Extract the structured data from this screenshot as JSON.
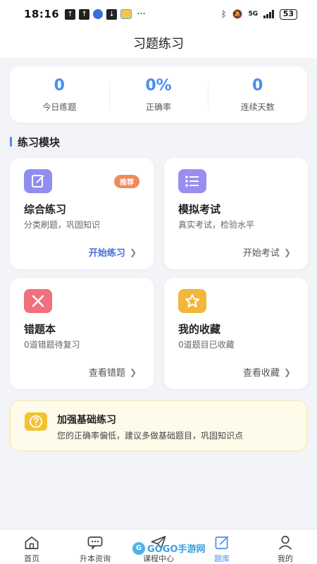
{
  "status_bar": {
    "time": "18:16",
    "more": "···",
    "network": "5G",
    "battery": "53"
  },
  "header": {
    "title": "习题练习"
  },
  "stats": [
    {
      "value": "0",
      "label": "今日练题"
    },
    {
      "value": "0%",
      "label": "正确率"
    },
    {
      "value": "0",
      "label": "连续天数"
    }
  ],
  "section": {
    "title": "练习模块"
  },
  "modules": [
    {
      "title": "综合练习",
      "desc": "分类刷题，巩固知识",
      "action": "开始练习",
      "badge": "推荐",
      "icon": "edit-icon",
      "icon_color": "#8f8ef0"
    },
    {
      "title": "模拟考试",
      "desc": "真实考试，检验水平",
      "action": "开始考试",
      "icon": "list-icon",
      "icon_color": "#9a8df0"
    },
    {
      "title": "错题本",
      "desc": "0道错题待复习",
      "action": "查看错题",
      "icon": "close-icon",
      "icon_color": "#f0707e"
    },
    {
      "title": "我的收藏",
      "desc": "0道题目已收藏",
      "action": "查看收藏",
      "icon": "star-icon",
      "icon_color": "#f3b63c"
    }
  ],
  "tip": {
    "title": "加强基础练习",
    "desc": "您的正确率偏低，建议多做基础题目，巩固知识点",
    "icon": "question-icon"
  },
  "tabbar": [
    {
      "label": "首页",
      "icon": "home-icon"
    },
    {
      "label": "升本资询",
      "icon": "chat-icon"
    },
    {
      "label": "课程中心",
      "icon": "send-icon"
    },
    {
      "label": "题库",
      "icon": "edit-icon",
      "active": true
    },
    {
      "label": "我的",
      "icon": "user-icon"
    }
  ],
  "watermark": {
    "text": "GOGO手游网"
  },
  "colors": {
    "accent": "#4a8df0",
    "badge": "#f08a5d",
    "tip_bg": "#fffbea"
  }
}
